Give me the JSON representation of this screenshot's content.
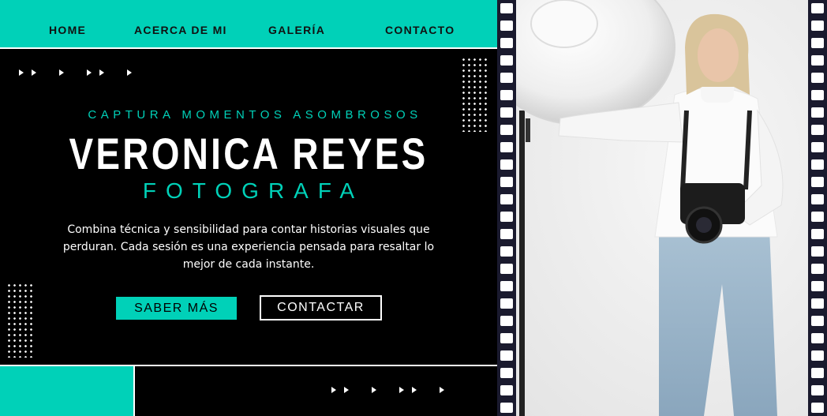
{
  "nav": {
    "items": [
      {
        "label": "HOME"
      },
      {
        "label": "ACERCA DE MI"
      },
      {
        "label": "GALERÍA"
      },
      {
        "label": "CONTACTO"
      }
    ]
  },
  "hero": {
    "tagline": "CAPTURA MOMENTOS ASOMBROSOS",
    "name": "VERONICA REYES",
    "role": "FOTOGRAFA",
    "description": "Combina técnica y sensibilidad para contar historias visuales que perduran. Cada sesión es una experiencia pensada para resaltar lo mejor de cada instante."
  },
  "buttons": {
    "primary_label": "SABER MÁS",
    "secondary_label": "CONTACTAR"
  },
  "colors": {
    "accent": "#00d1b8",
    "background": "#000000",
    "text": "#ffffff",
    "film": "#1a1a2e"
  },
  "icons": {
    "decor_arrows": "play-arrow-icon",
    "decor_dots": "dot-grid"
  }
}
